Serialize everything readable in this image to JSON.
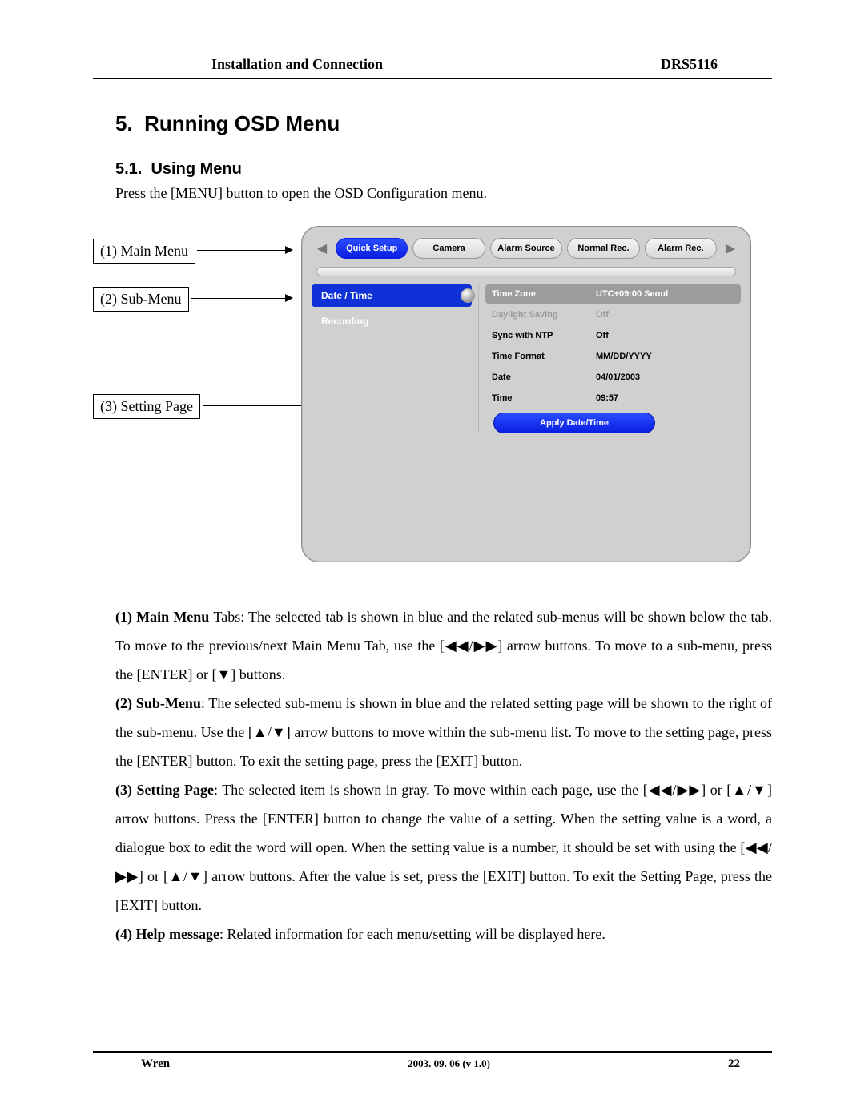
{
  "header": {
    "left": "Installation and Connection",
    "right": "DRS5116"
  },
  "section": {
    "num": "5.",
    "title": "Running OSD Menu"
  },
  "subsection": {
    "num": "5.1.",
    "title": "Using Menu"
  },
  "intro": "Press the [MENU] button to open the OSD Configuration menu.",
  "callouts": {
    "c1": "(1) Main Menu",
    "c2": "(2) Sub-Menu",
    "c3": "(3) Setting Page"
  },
  "osd": {
    "tabs": [
      "Quick Setup",
      "Camera",
      "Alarm Source",
      "Normal Rec.",
      "Alarm Rec."
    ],
    "submenu": [
      "Date / Time",
      "Recording"
    ],
    "settings": [
      {
        "label": "Time Zone",
        "value": "UTC+09:00 Seoul",
        "sel": true
      },
      {
        "label": "Daylight Saving",
        "value": "Off",
        "dim": true
      },
      {
        "label": "Sync with NTP",
        "value": "Off"
      },
      {
        "label": "Time Format",
        "value": "MM/DD/YYYY"
      },
      {
        "label": "Date",
        "value": "04/01/2003"
      },
      {
        "label": "Time",
        "value": "09:57"
      }
    ],
    "apply": "Apply Date/Time"
  },
  "para": {
    "p1a": "(1) Main Menu ",
    "p1b": "Tabs: The selected tab is shown in blue and the related sub-menus will be shown below the tab.    To move to the previous/next Main Menu Tab, use the [◀◀/▶▶] arrow buttons.    To move to a sub-menu, press the [ENTER] or [▼] buttons.",
    "p2a": "(2) Sub-Menu",
    "p2b": ": The selected sub-menu is shown in blue and the related setting page will be shown to the right of the sub-menu. Use the [▲/▼] arrow buttons to move within the sub-menu list.   To move to the setting page, press the [ENTER] button.    To exit the setting page, press the [EXIT] button.",
    "p3a": "(3) Setting Page",
    "p3b": ": The selected item is shown in gray.    To move within each page, use the [◀◀/▶▶] or [▲/▼] arrow buttons.    Press the [ENTER] button to change the value of a setting.    When the setting value is a word, a dialogue box to edit the word will open.    When the setting value is a number, it should be set with using the [◀◀/▶▶] or [▲/▼] arrow buttons.   After the value is set, press the [EXIT] button.    To exit the Setting Page, press the [EXIT] button.",
    "p4a": "(4) Help message",
    "p4b": ": Related information for each menu/setting will be displayed here."
  },
  "footer": {
    "left": "Wren",
    "center": "2003. 09. 06 (v 1.0)",
    "right": "22"
  }
}
